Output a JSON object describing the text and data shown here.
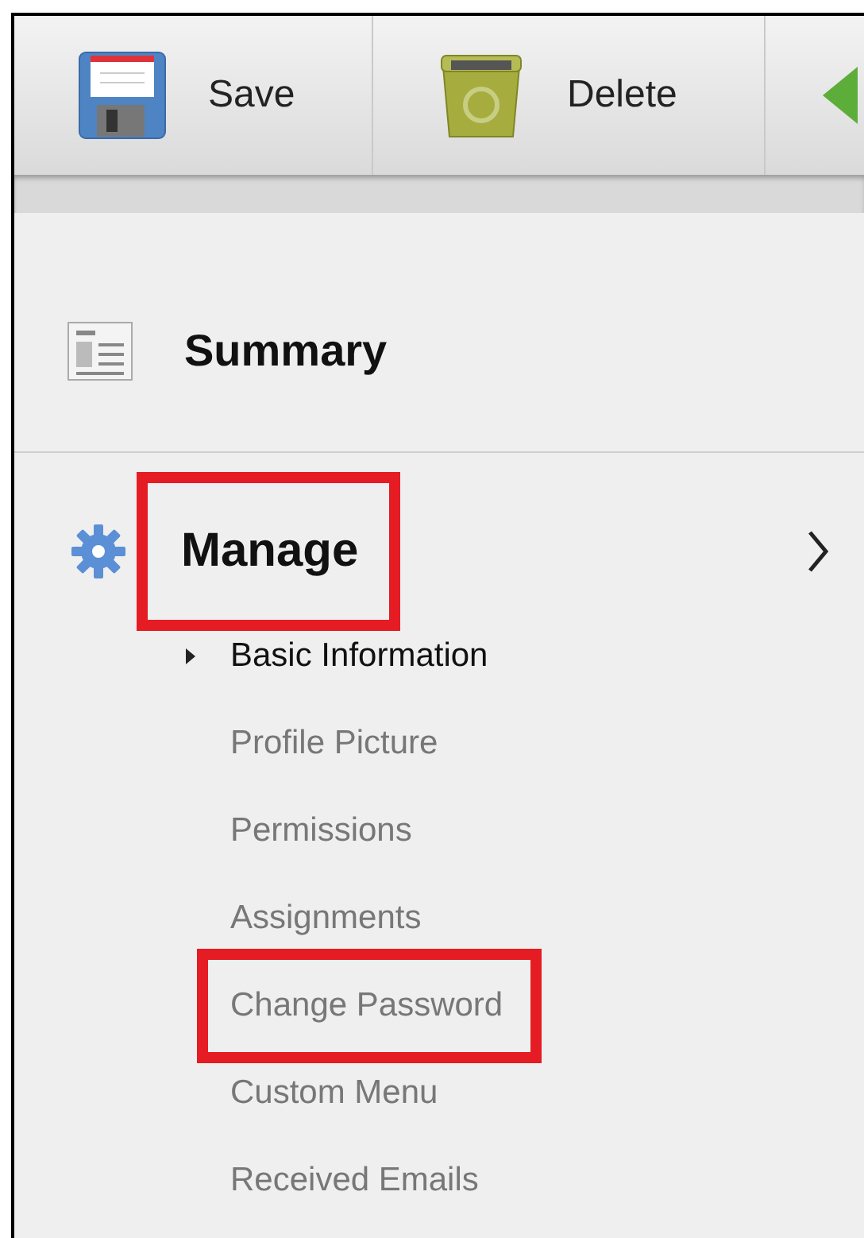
{
  "toolbar": {
    "buttons": [
      {
        "kind": "save",
        "label": "Save"
      },
      {
        "kind": "delete",
        "label": "Delete"
      },
      {
        "kind": "arrow"
      }
    ]
  },
  "sections": [
    {
      "kind": "summary",
      "label": "Summary",
      "annotated": false,
      "expandable": false
    },
    {
      "kind": "manage",
      "label": "Manage",
      "annotated": true,
      "expandable": true,
      "items": [
        {
          "label": "Basic Information",
          "selected": true,
          "annotated": false
        },
        {
          "label": "Profile Picture",
          "selected": false,
          "annotated": false
        },
        {
          "label": "Permissions",
          "selected": false,
          "annotated": false
        },
        {
          "label": "Assignments",
          "selected": false,
          "annotated": false
        },
        {
          "label": "Change Password",
          "selected": false,
          "annotated": true
        },
        {
          "label": "Custom Menu",
          "selected": false,
          "annotated": false
        },
        {
          "label": "Received Emails",
          "selected": false,
          "annotated": false
        }
      ]
    }
  ]
}
